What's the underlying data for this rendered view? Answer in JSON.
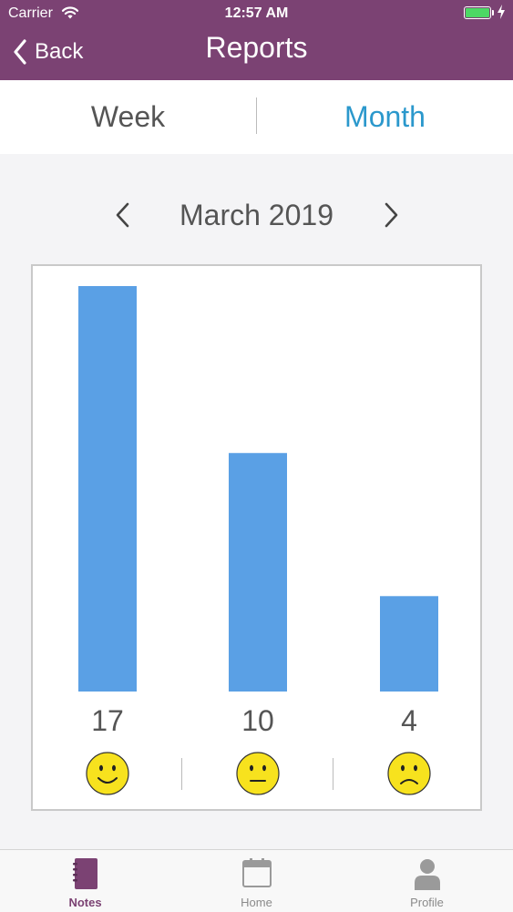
{
  "status_bar": {
    "carrier": "Carrier",
    "time": "12:57 AM",
    "icons": [
      "wifi-icon",
      "battery-icon",
      "charging-icon"
    ]
  },
  "nav": {
    "back_label": "Back",
    "title": "Reports"
  },
  "segment": {
    "options": [
      "Week",
      "Month"
    ],
    "selected": "Month",
    "selected_color": "#2b98cc"
  },
  "period": {
    "label": "March 2019",
    "prev_icon": "chevron-left-icon",
    "next_icon": "chevron-right-icon"
  },
  "colors": {
    "brand": "#7b4273",
    "bar": "#5aa0e5",
    "emoji": "#f7e21e"
  },
  "chart_data": {
    "type": "bar",
    "categories": [
      "happy",
      "neutral",
      "sad"
    ],
    "values": [
      17,
      10,
      4
    ],
    "ylim": [
      0,
      17
    ],
    "grid": false,
    "category_icons": [
      "smiley-happy-icon",
      "smiley-neutral-icon",
      "smiley-sad-icon"
    ]
  },
  "tabbar": {
    "items": [
      {
        "label": "Notes",
        "icon": "notebook-icon",
        "active": true
      },
      {
        "label": "Home",
        "icon": "calendar-icon",
        "active": false
      },
      {
        "label": "Profile",
        "icon": "person-icon",
        "active": false
      }
    ]
  }
}
